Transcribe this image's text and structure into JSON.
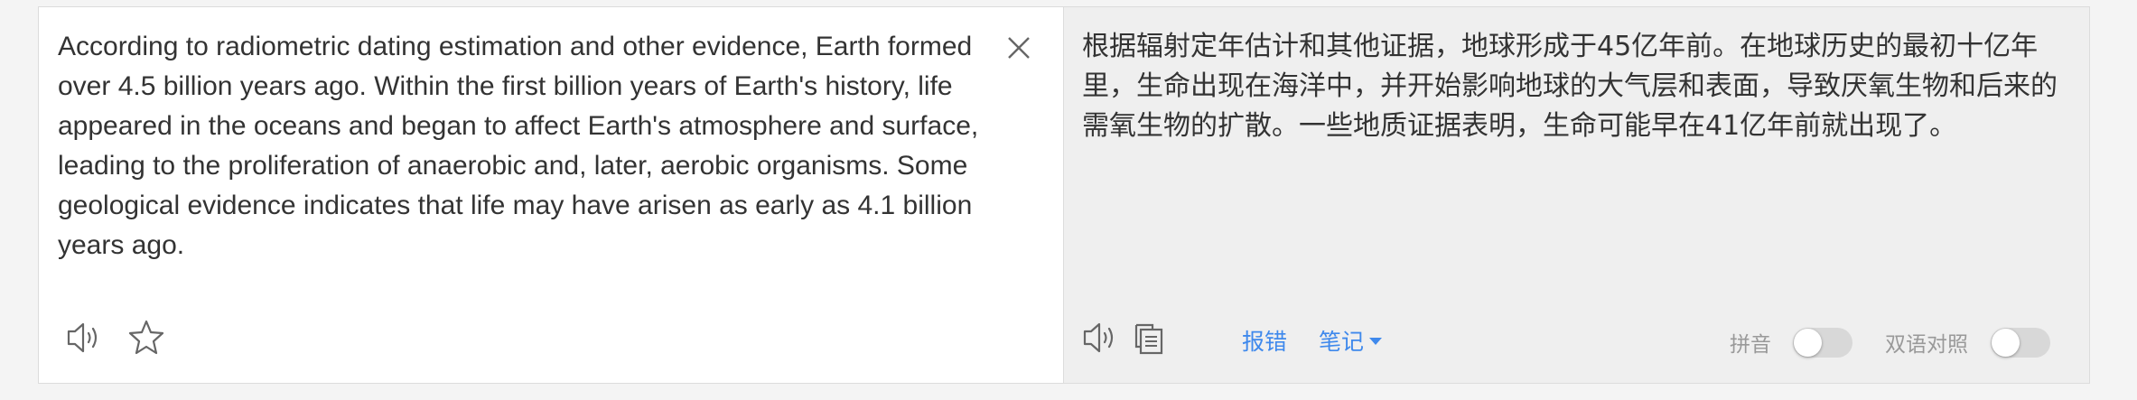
{
  "source": {
    "text": "According to radiometric dating estimation and other evidence, Earth formed over 4.5 billion years ago. Within the first billion years of Earth's history, life appeared in the oceans and began to affect Earth's atmosphere and surface, leading to the proliferation of anaerobic and, later, aerobic organisms. Some geological evidence indicates that life may have arisen as early as 4.1 billion years ago.",
    "icons": {
      "clear": "close-icon",
      "speak": "speaker-icon",
      "favorite": "star-icon"
    }
  },
  "target": {
    "text": "根据辐射定年估计和其他证据，地球形成于45亿年前。在地球历史的最初十亿年里，生命出现在海洋中，并开始影响地球的大气层和表面，导致厌氧生物和后来的需氧生物的扩散。一些地质证据表明，生命可能早在41亿年前就出现了。",
    "icons": {
      "speak": "speaker-icon",
      "copy": "copy-icon"
    },
    "report_label": "报错",
    "notes_label": "笔记",
    "pinyin_label": "拼音",
    "pinyin_on": false,
    "bilingual_label": "双语对照",
    "bilingual_on": false
  },
  "colors": {
    "link": "#3f89ec",
    "text": "#333333",
    "muted": "#999999",
    "toggle_off": "#d8d8d8"
  }
}
